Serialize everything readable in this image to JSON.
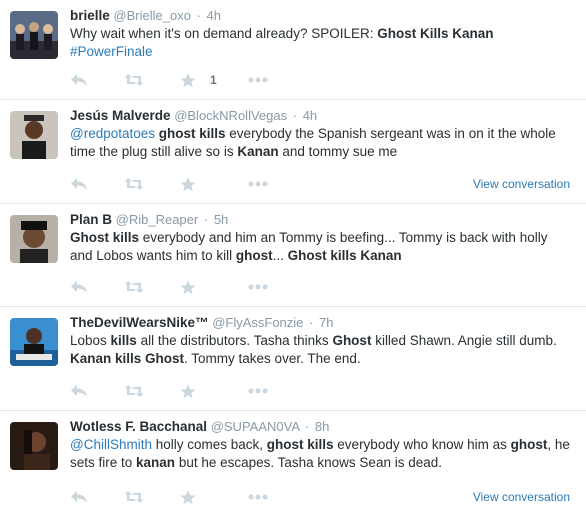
{
  "tweets": [
    {
      "fullname": "brielle",
      "username": "@Brielle_oxo",
      "sep": "·",
      "time": "4h",
      "text_parts": [
        "Why wait when it's on demand already? SPOILER: ",
        "Ghost Kills Kanan",
        "#PowerFinale"
      ],
      "favorite_count": "1"
    },
    {
      "fullname": "Jesús Malverde",
      "username": "@BlockNRollVegas",
      "sep": "·",
      "time": "4h",
      "text_parts": [
        "@redpotatoes",
        " ",
        "ghost kills",
        " everybody the Spanish sergeant was in on it the whole time the plug still alive so is ",
        "Kanan",
        " and tommy sue me"
      ],
      "view_conversation": "View conversation"
    },
    {
      "fullname": "Plan B",
      "username": "@Rib_Reaper",
      "sep": "·",
      "time": "5h",
      "text_parts": [
        "Ghost kills",
        " everybody and him an Tommy is beefing... Tommy is back with holly and Lobos wants him to kill ",
        "ghost",
        "... ",
        "Ghost kills Kanan"
      ]
    },
    {
      "fullname": "TheDevilWearsNike™",
      "username": "@FlyAssFonzie",
      "sep": "·",
      "time": "7h",
      "text_parts": [
        "Lobos ",
        "kills",
        " all the distributors. Tasha thinks ",
        "Ghost",
        " killed Shawn. Angie still dumb. ",
        "Kanan kills Ghost",
        ". Tommy takes over. The end."
      ]
    },
    {
      "fullname": "Wotless F. Bacchanal",
      "username": "@SUPAAN0VA",
      "sep": "·",
      "time": "8h",
      "text_parts": [
        "@ChillShmith",
        " holly comes back, ",
        "ghost kills",
        " everybody who know him as ",
        "ghost",
        ", he sets fire to ",
        "kanan",
        " but he escapes. Tasha knows Sean is dead."
      ],
      "view_conversation": "View conversation"
    }
  ],
  "icons": {
    "reply": "reply-icon",
    "retweet": "retweet-icon",
    "favorite": "star-icon",
    "more": "more-dots-icon"
  },
  "colors": {
    "link": "#2b7bb9",
    "icon": "#ccd6dd",
    "muted": "#8899a6",
    "text": "#292f33",
    "divider": "#e1e8ed"
  }
}
